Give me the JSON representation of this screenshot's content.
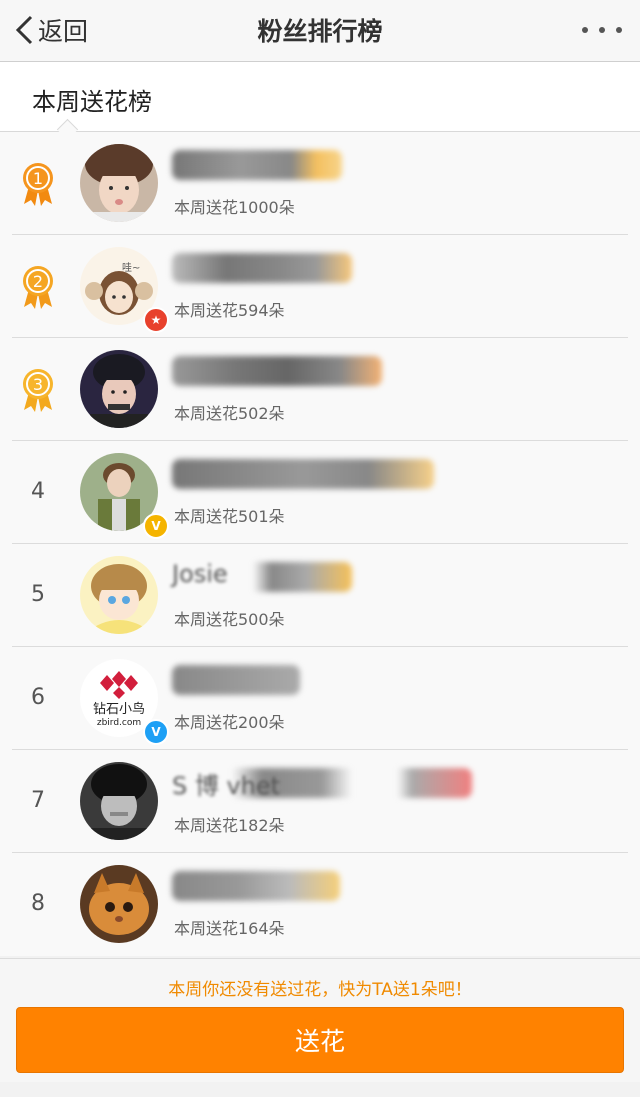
{
  "nav": {
    "back_label": "返回",
    "title": "粉丝排行榜",
    "more_icon": "more-dots-icon"
  },
  "tabs": [
    {
      "label": "本周送花榜",
      "active": true
    }
  ],
  "ranking": [
    {
      "rank": "1",
      "flowers": "本周送花1000朵",
      "medal": "gold",
      "medal_color": "#f5951e",
      "name_text": "",
      "badge": ""
    },
    {
      "rank": "2",
      "flowers": "本周送花594朵",
      "medal": "silver",
      "medal_color": "#f5a623",
      "name_text": "",
      "badge": "star"
    },
    {
      "rank": "3",
      "flowers": "本周送花502朵",
      "medal": "bronze",
      "medal_color": "#f7b52c",
      "name_text": "",
      "badge": ""
    },
    {
      "rank": "4",
      "flowers": "本周送花501朵",
      "name_text": "",
      "badge": "v-yellow"
    },
    {
      "rank": "5",
      "flowers": "本周送花500朵",
      "name_text": "Josie",
      "badge": ""
    },
    {
      "rank": "6",
      "flowers": "本周送花200朵",
      "name_text": "",
      "badge": "v-blue"
    },
    {
      "rank": "7",
      "flowers": "本周送花182朵",
      "name_text": "S    博     vhet",
      "badge": ""
    },
    {
      "rank": "8",
      "flowers": "本周送花164朵",
      "name_text": "",
      "badge": ""
    }
  ],
  "footer": {
    "hint": "本周你还没有送过花，快为TA送1朵吧！",
    "button_label": "送花"
  },
  "colors": {
    "accent": "#ff8200",
    "hint_text": "#f08a00",
    "badge_blue": "#1ea0f5",
    "badge_yellow": "#f5b400",
    "badge_red": "#e8412c"
  }
}
